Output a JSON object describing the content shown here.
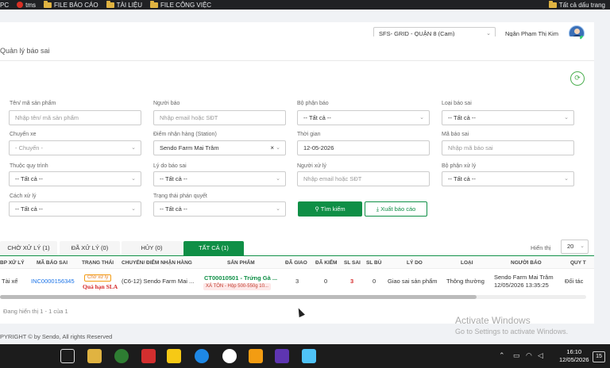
{
  "bookmarks": {
    "items": [
      "PC",
      "tms",
      "FILE BÁO CÁO",
      "TÀI LIỆU",
      "FILE CÔNG VIỆC"
    ],
    "right": "Tất cả dấu trang"
  },
  "header": {
    "store": "SFS- GRID - QUẬN 8 (Cam)",
    "user": "Ngân Phạm Thị Kim"
  },
  "page": {
    "title": "Quản lý báo sai"
  },
  "filters": {
    "product": {
      "label": "Tên/ mã sản phẩm",
      "placeholder": "Nhập tên/ mã sản phẩm"
    },
    "reporter": {
      "label": "Người báo",
      "placeholder": "Nhập email hoặc SĐT"
    },
    "report_dept": {
      "label": "Bộ phận báo",
      "value": "-- Tất cả --"
    },
    "error_type": {
      "label": "Loại báo sai",
      "value": "-- Tất cả --"
    },
    "trip": {
      "label": "Chuyến xe",
      "value": "- Chuyến -"
    },
    "station": {
      "label": "Điểm nhận hàng (Station)",
      "value": "Sendo Farm Mai Trâm"
    },
    "time": {
      "label": "Thời gian",
      "value": "12-05-2026"
    },
    "error_code": {
      "label": "Mã báo sai",
      "placeholder": "Nhập mã báo sai"
    },
    "process": {
      "label": "Thuộc quy trình",
      "value": "-- Tất cả --"
    },
    "reason": {
      "label": "Lý do báo sai",
      "value": "-- Tất cả --"
    },
    "handler": {
      "label": "Người xử lý",
      "placeholder": "Nhập email hoặc SĐT"
    },
    "handler_dept": {
      "label": "Bộ phận xử lý",
      "value": "-- Tất cả --"
    },
    "method": {
      "label": "Cách xử lý",
      "value": "-- Tất cả --"
    },
    "decision": {
      "label": "Trạng thái phán quyết",
      "value": "-- Tất cả --"
    }
  },
  "buttons": {
    "search": "Tìm kiếm",
    "export": "Xuất báo cáo"
  },
  "tabs": [
    {
      "label": "CHỜ XỬ LÝ (1)"
    },
    {
      "label": "ĐÃ XỬ LÝ (0)"
    },
    {
      "label": "HỦY (0)"
    },
    {
      "label": "TẤT CẢ (1)"
    }
  ],
  "pagination": {
    "per_page_label": "Hiển thị",
    "per_page": "20",
    "showing": "Đang hiển thị 1 - 1 của 1"
  },
  "table": {
    "columns": [
      "BP XỬ LÝ",
      "MÃ BÁO SAI",
      "TRẠNG THÁI",
      "CHUYẾN/ ĐIỂM NHẬN HÀNG",
      "SẢN PHẨM",
      "ĐÃ GIAO",
      "ĐÃ KIỂM",
      "SL SAI",
      "SL BÙ",
      "LÝ DO",
      "LOẠI",
      "NGƯỜI BÁO",
      "QUY T"
    ],
    "row": {
      "dept": "Tài xế",
      "code": "INC0000156345",
      "status": "Chờ xử lý",
      "sla": "Quá hạn SLA",
      "trip": "(C6-12) Sendo Farm Mai ...",
      "product_code": "CT00010501 - Trứng Gà ...",
      "product_tag": "XÁ TÔN - Hộp 500-550g 10...",
      "delivered": "3",
      "checked": "0",
      "wrong": "3",
      "compensate": "0",
      "reason": "Giao sai sản phẩm",
      "type": "Thông thường",
      "reporter": "Sendo Farm Mai Trâm",
      "reported_at": "12/05/2026 13:35:25",
      "rule": "Đối tác"
    }
  },
  "footer": "PYRIGHT © by Sendo, All rights Reserved",
  "watermark": {
    "title": "Activate Windows",
    "sub": "Go to Settings to activate Windows."
  },
  "taskbar": {
    "time": "16:10",
    "date": "12/05/2026",
    "notifications": "15"
  }
}
